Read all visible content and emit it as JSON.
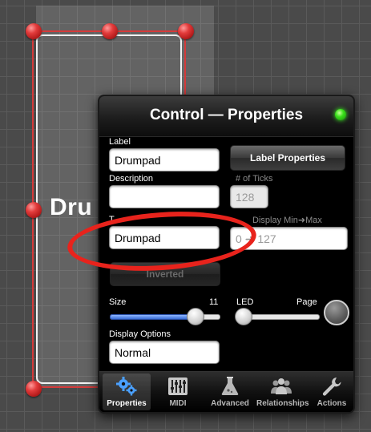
{
  "canvas": {
    "control_label": "Dru"
  },
  "panel": {
    "title": "Control — Properties",
    "label": {
      "caption": "Label",
      "value": "Drumpad"
    },
    "label_properties_button": "Label Properties",
    "description": {
      "caption": "Description",
      "value": ""
    },
    "ticks": {
      "caption": "# of Ticks",
      "value": "128"
    },
    "type": {
      "caption": "T",
      "value": "Drumpad"
    },
    "display_range": {
      "caption": "Display Min➜Max",
      "value_left": "0",
      "value_right": "127"
    },
    "inverted_button": "Inverted",
    "size": {
      "caption": "Size",
      "value": "11",
      "fraction": 0.78
    },
    "led": {
      "caption": "LED"
    },
    "page": {
      "caption": "Page"
    },
    "display_options": {
      "caption": "Display Options",
      "value": "Normal"
    }
  },
  "tabbar": {
    "tabs": [
      {
        "label": "Properties",
        "icon": "gears-icon",
        "active": true
      },
      {
        "label": "MIDI",
        "icon": "mixer-icon",
        "active": false
      },
      {
        "label": "Advanced",
        "icon": "flask-icon",
        "active": false
      },
      {
        "label": "Relationships",
        "icon": "people-icon",
        "active": false
      },
      {
        "label": "Actions",
        "icon": "wrench-icon",
        "active": false
      }
    ]
  },
  "colors": {
    "handle": "#e23b3b",
    "status_led": "#39e01a",
    "annotation": "#e8231c",
    "slider_fill": "#3b6fd8"
  }
}
